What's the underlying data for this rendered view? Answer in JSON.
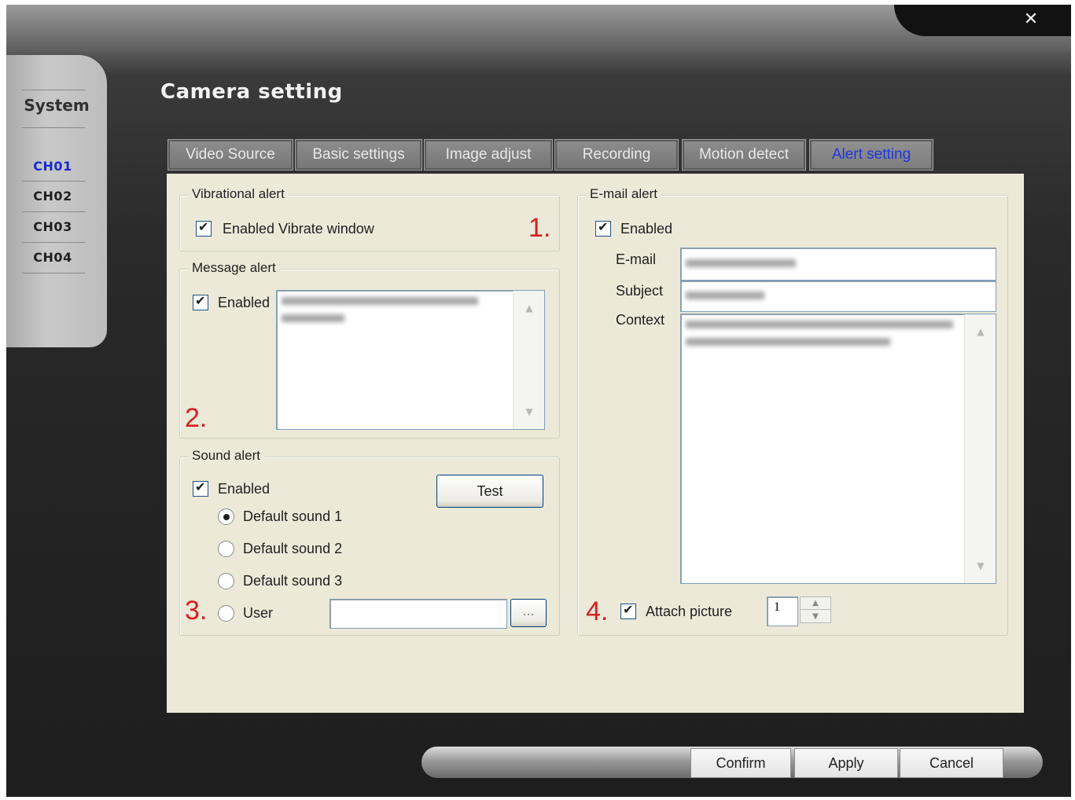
{
  "window": {
    "close_glyph": "✕"
  },
  "sidebar": {
    "title": "System",
    "channels": [
      {
        "label": "CH01",
        "active": true
      },
      {
        "label": "CH02",
        "active": false
      },
      {
        "label": "CH03",
        "active": false
      },
      {
        "label": "CH04",
        "active": false
      }
    ]
  },
  "page_title": "Camera setting",
  "tabs": [
    {
      "label": "Video Source",
      "active": false
    },
    {
      "label": "Basic settings",
      "active": false
    },
    {
      "label": "Image adjust",
      "active": false
    },
    {
      "label": "Recording",
      "active": false
    },
    {
      "label": "Motion detect",
      "active": false
    },
    {
      "label": "Alert setting",
      "active": true
    }
  ],
  "vibrational_alert": {
    "legend": "Vibrational alert",
    "checkbox_label": "Enabled Vibrate window",
    "checked": true,
    "marker": "1."
  },
  "message_alert": {
    "legend": "Message alert",
    "checkbox_label": "Enabled",
    "checked": true,
    "marker": "2."
  },
  "sound_alert": {
    "legend": "Sound alert",
    "checkbox_label": "Enabled",
    "checked": true,
    "test_button": "Test",
    "options": [
      "Default sound 1",
      "Default sound 2",
      "Default sound 3",
      "User"
    ],
    "selected_index": 0,
    "browse_button": "...",
    "marker": "3."
  },
  "email_alert": {
    "legend": "E-mail alert",
    "checkbox_label": "Enabled",
    "checked": true,
    "email_label": "E-mail",
    "subject_label": "Subject",
    "context_label": "Context",
    "attach_label": "Attach picture",
    "attach_checked": true,
    "attach_count": "1",
    "marker": "4."
  },
  "footer": {
    "confirm": "Confirm",
    "apply": "Apply",
    "cancel": "Cancel"
  },
  "colors": {
    "active_tab": "#2036e0",
    "active_channel": "#1a2bd1",
    "marker": "#d42020",
    "panel": "#ece9d8"
  }
}
